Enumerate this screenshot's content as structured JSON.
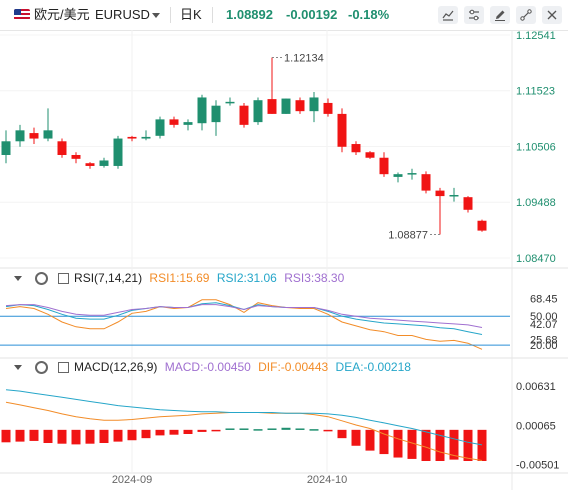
{
  "toolbar": {
    "symbol_name": "欧元/美元",
    "symbol_code": "EURUSD",
    "timeframe": "日K",
    "last_price": "1.08892",
    "change": "-0.00192",
    "change_pct": "-0.18%",
    "icons": [
      "flag-icon",
      "chevron-down-icon",
      "candle-chart-icon",
      "chart-settings-icon",
      "draw-pencil-icon",
      "indicator-icon",
      "collapse-icon",
      "close-icon"
    ]
  },
  "colors": {
    "up": "#1f8f6f",
    "down": "#f01414",
    "accent_blue": "#2962ff",
    "price_label": "#1f8f6f",
    "rsi1": "#f28c28",
    "rsi2": "#26a6c9",
    "rsi3": "#a070d0",
    "macd": "#a070d0",
    "dif": "#f28c28",
    "dea": "#26a6c9",
    "ref_line": "#2a8fd6"
  },
  "price_axis": {
    "ticks": [
      "1.12541",
      "1.11523",
      "1.10506",
      "1.09488",
      "1.08470"
    ],
    "high_label": "1.12134",
    "low_label": "1.08877"
  },
  "rsi_panel": {
    "title": "RSI(7,14,21)",
    "rsi1": "RSI1:15.69",
    "rsi2": "RSI2:31.06",
    "rsi3": "RSI3:38.30",
    "ticks": [
      "68.45",
      "50.00",
      "42.07",
      "25.68",
      "20.00"
    ]
  },
  "macd_panel": {
    "title": "MACD(12,26,9)",
    "macd": "MACD:-0.00450",
    "dif": "DIF:-0.00443",
    "dea": "DEA:-0.00218",
    "ticks": [
      "0.00631",
      "0.00065",
      "-0.00501"
    ]
  },
  "x_axis": {
    "labels": [
      "2024-09",
      "2024-10"
    ]
  },
  "chart_data": [
    {
      "type": "candlestick",
      "title": "欧元/美元 EURUSD 日K",
      "x": [
        "2024-09",
        "2024-10"
      ],
      "ylim": [
        1.0847,
        1.1254
      ],
      "candles": [
        {
          "o": 1.1035,
          "h": 1.108,
          "l": 1.102,
          "c": 1.106
        },
        {
          "o": 1.106,
          "h": 1.109,
          "l": 1.105,
          "c": 1.108
        },
        {
          "o": 1.1075,
          "h": 1.1085,
          "l": 1.1055,
          "c": 1.1065
        },
        {
          "o": 1.1065,
          "h": 1.112,
          "l": 1.106,
          "c": 1.108
        },
        {
          "o": 1.106,
          "h": 1.1065,
          "l": 1.103,
          "c": 1.1035
        },
        {
          "o": 1.1035,
          "h": 1.104,
          "l": 1.102,
          "c": 1.1028
        },
        {
          "o": 1.102,
          "h": 1.1022,
          "l": 1.101,
          "c": 1.1015
        },
        {
          "o": 1.1015,
          "h": 1.103,
          "l": 1.1012,
          "c": 1.1025
        },
        {
          "o": 1.1015,
          "h": 1.107,
          "l": 1.101,
          "c": 1.1065
        },
        {
          "o": 1.1068,
          "h": 1.107,
          "l": 1.106,
          "c": 1.1065
        },
        {
          "o": 1.1065,
          "h": 1.108,
          "l": 1.1062,
          "c": 1.1068
        },
        {
          "o": 1.107,
          "h": 1.1105,
          "l": 1.1065,
          "c": 1.11
        },
        {
          "o": 1.11,
          "h": 1.1105,
          "l": 1.1085,
          "c": 1.109
        },
        {
          "o": 1.109,
          "h": 1.11,
          "l": 1.108,
          "c": 1.1095
        },
        {
          "o": 1.1093,
          "h": 1.1145,
          "l": 1.108,
          "c": 1.114
        },
        {
          "o": 1.1095,
          "h": 1.1135,
          "l": 1.107,
          "c": 1.1125
        },
        {
          "o": 1.113,
          "h": 1.114,
          "l": 1.1125,
          "c": 1.1132
        },
        {
          "o": 1.1125,
          "h": 1.113,
          "l": 1.1085,
          "c": 1.109
        },
        {
          "o": 1.1095,
          "h": 1.114,
          "l": 1.109,
          "c": 1.1135
        },
        {
          "o": 1.1137,
          "h": 1.1213,
          "l": 1.111,
          "c": 1.111
        },
        {
          "o": 1.111,
          "h": 1.1138,
          "l": 1.111,
          "c": 1.1138
        },
        {
          "o": 1.1135,
          "h": 1.114,
          "l": 1.111,
          "c": 1.1115
        },
        {
          "o": 1.1115,
          "h": 1.115,
          "l": 1.1095,
          "c": 1.114
        },
        {
          "o": 1.113,
          "h": 1.1138,
          "l": 1.1105,
          "c": 1.111
        },
        {
          "o": 1.111,
          "h": 1.112,
          "l": 1.104,
          "c": 1.105
        },
        {
          "o": 1.1055,
          "h": 1.106,
          "l": 1.1035,
          "c": 1.104
        },
        {
          "o": 1.104,
          "h": 1.1042,
          "l": 1.1028,
          "c": 1.103
        },
        {
          "o": 1.103,
          "h": 1.104,
          "l": 1.0995,
          "c": 1.1
        },
        {
          "o": 1.0995,
          "h": 1.1003,
          "l": 1.0985,
          "c": 1.1
        },
        {
          "o": 1.1,
          "h": 1.101,
          "l": 1.099,
          "c": 1.1002
        },
        {
          "o": 1.1,
          "h": 1.1005,
          "l": 1.0965,
          "c": 1.097
        },
        {
          "o": 1.097,
          "h": 1.0975,
          "l": 1.089,
          "c": 1.096
        },
        {
          "o": 1.096,
          "h": 1.0975,
          "l": 1.095,
          "c": 1.0962
        },
        {
          "o": 1.0958,
          "h": 1.096,
          "l": 1.093,
          "c": 1.0935
        },
        {
          "o": 1.0915,
          "h": 1.0917,
          "l": 1.0895,
          "c": 1.0897
        }
      ]
    },
    {
      "type": "line",
      "title": "RSI(7,14,21)",
      "ylim": [
        15,
        72
      ],
      "reference_lines": [
        50
      ],
      "series": [
        {
          "name": "RSI1",
          "values": [
            58,
            60,
            58,
            52,
            44,
            39,
            37,
            37,
            44,
            53,
            55,
            60,
            58,
            59,
            67,
            67,
            62,
            54,
            64,
            61,
            59,
            58,
            58,
            52,
            44,
            40,
            36,
            34,
            30,
            30,
            26,
            24,
            25,
            22,
            15.69
          ]
        },
        {
          "name": "RSI2",
          "values": [
            60,
            62,
            61,
            57,
            52,
            48,
            47,
            47,
            51,
            56,
            58,
            60,
            59,
            59,
            63,
            64,
            61,
            57,
            62,
            60,
            59,
            59,
            59,
            55,
            50,
            47,
            45,
            43,
            42,
            41,
            40,
            38,
            37,
            34,
            31.06
          ]
        },
        {
          "name": "RSI3",
          "values": [
            61,
            62,
            62,
            59,
            55,
            52,
            51,
            51,
            54,
            57,
            58,
            60,
            59,
            59,
            62,
            62,
            60,
            57,
            61,
            60,
            59,
            59,
            59,
            56,
            52,
            50,
            48,
            47,
            46,
            45,
            44,
            43,
            42,
            41,
            38.3
          ]
        }
      ]
    },
    {
      "type": "bar",
      "title": "MACD(12,26,9)",
      "ylim": [
        -0.0058,
        0.0072
      ],
      "series": [
        {
          "name": "MACD",
          "values": [
            -0.0018,
            -0.0017,
            -0.0016,
            -0.0019,
            -0.002,
            -0.0021,
            -0.002,
            -0.0019,
            -0.0017,
            -0.0015,
            -0.0012,
            -0.0008,
            -0.0007,
            -0.0006,
            -0.0003,
            -0.0001,
            0.0002,
            0.0002,
            0.0001,
            0.0002,
            0.0003,
            0.0002,
            0.0001,
            -0.0002,
            -0.0012,
            -0.0023,
            -0.003,
            -0.0035,
            -0.004,
            -0.0042,
            -0.0045,
            -0.0045,
            -0.0043,
            -0.0045,
            -0.0045
          ]
        },
        {
          "name": "DIF",
          "values": [
            0.004,
            0.0036,
            0.0032,
            0.0028,
            0.0023,
            0.0019,
            0.0016,
            0.0014,
            0.0014,
            0.0015,
            0.0017,
            0.0019,
            0.002,
            0.0021,
            0.0023,
            0.0024,
            0.0025,
            0.0025,
            0.0025,
            0.0024,
            0.0024,
            0.0024,
            0.0022,
            0.0019,
            0.0013,
            0.0007,
            0.0002,
            -0.0006,
            -0.0013,
            -0.0019,
            -0.0025,
            -0.0032,
            -0.0037,
            -0.0041,
            -0.00443
          ]
        },
        {
          "name": "DEA",
          "values": [
            0.0058,
            0.0056,
            0.0053,
            0.005,
            0.0047,
            0.0044,
            0.0041,
            0.0038,
            0.0035,
            0.0033,
            0.0031,
            0.0029,
            0.0028,
            0.0027,
            0.0026,
            0.0026,
            0.0025,
            0.0025,
            0.0025,
            0.0025,
            0.0024,
            0.0024,
            0.0024,
            0.0023,
            0.0021,
            0.0018,
            0.0014,
            0.001,
            0.0006,
            0.0002,
            -0.0003,
            -0.0008,
            -0.0013,
            -0.0018,
            -0.00218
          ]
        }
      ]
    }
  ]
}
